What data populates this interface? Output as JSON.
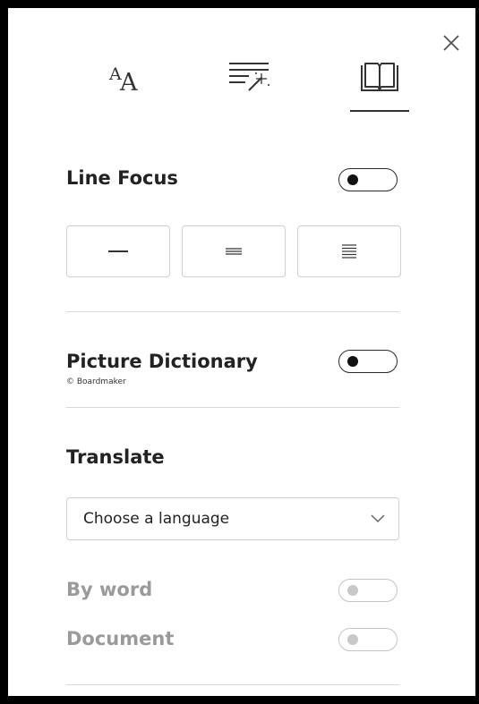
{
  "panel": {
    "close_icon": "close-icon",
    "tabs": [
      {
        "name": "text-options",
        "icon": "text-size-icon",
        "glyph_large": "A",
        "glyph_small": "A",
        "selected": false
      },
      {
        "name": "reading-preferences",
        "icon": "text-preferences-icon",
        "selected": false
      },
      {
        "name": "grammar-options",
        "icon": "book-icon",
        "selected": true
      }
    ]
  },
  "line_focus": {
    "label": "Line Focus",
    "enabled": false,
    "options": [
      {
        "name": "one-line",
        "icon": "one-line-icon"
      },
      {
        "name": "three-lines",
        "icon": "three-lines-icon"
      },
      {
        "name": "five-lines",
        "icon": "five-lines-icon"
      }
    ]
  },
  "picture_dictionary": {
    "label": "Picture Dictionary",
    "credit": "© Boardmaker",
    "enabled": false
  },
  "translate": {
    "label": "Translate",
    "language_select": {
      "value": "Choose a language",
      "icon": "chevron-down-icon"
    },
    "by_word": {
      "label": "By word",
      "enabled": false,
      "disabled": true
    },
    "document": {
      "label": "Document",
      "enabled": false,
      "disabled": true
    }
  },
  "colors": {
    "text": "#222222",
    "disabled_text": "#9a9a9a",
    "border": "#cfcfcf",
    "window_frame": "#000000"
  }
}
